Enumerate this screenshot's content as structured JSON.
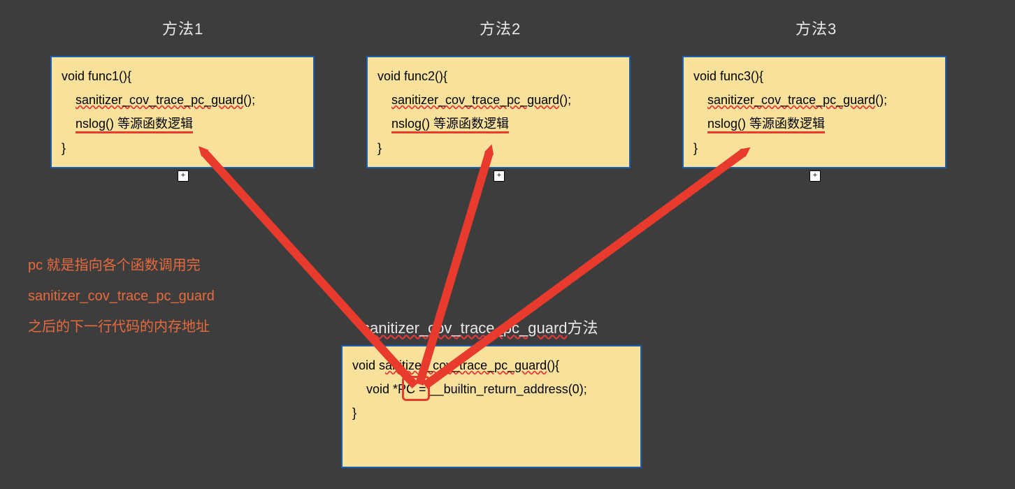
{
  "titles": {
    "m1": "方法1",
    "m2": "方法2",
    "m3": "方法3",
    "bottom_plain1": "s",
    "bottom_wavy": "anitizer_cov_trace_pc_guard",
    "bottom_plain2": "方法"
  },
  "boxes": {
    "func1": {
      "l1": "void func1(){",
      "l2a": "    ",
      "l2b": "sanitizer_cov_trace_pc_guard",
      "l2c": "();",
      "l3a": "    ",
      "l3b": "nslog() 等源函数逻辑",
      "l4": "}"
    },
    "func2": {
      "l1": "void func2(){",
      "l2a": "    ",
      "l2b": "sanitizer_cov_trace_pc_guard",
      "l2c": "();",
      "l3a": "    ",
      "l3b": "nslog() 等源函数逻辑",
      "l4": "}"
    },
    "func3": {
      "l1": "void func3(){",
      "l2a": "    ",
      "l2b": "sanitizer_cov_trace_pc_guard",
      "l2c": "();",
      "l3a": "    ",
      "l3b": "nslog() 等源函数逻辑",
      "l4": "}"
    },
    "bottom": {
      "l1a": "void s",
      "l1b": "anitizer_cov_trace_pc_guard",
      "l1c": "(){",
      "l2a": "    void *",
      "l2b": "PC",
      "l2c": " = __builtin_return_address(0);",
      "l4": "}"
    }
  },
  "annotation": {
    "a1": "pc 就是指向各个函数调用完",
    "a2": "sanitizer_cov_trace_pc_guard",
    "a3": "之后的下一行代码的内存地址"
  },
  "plus": "+"
}
